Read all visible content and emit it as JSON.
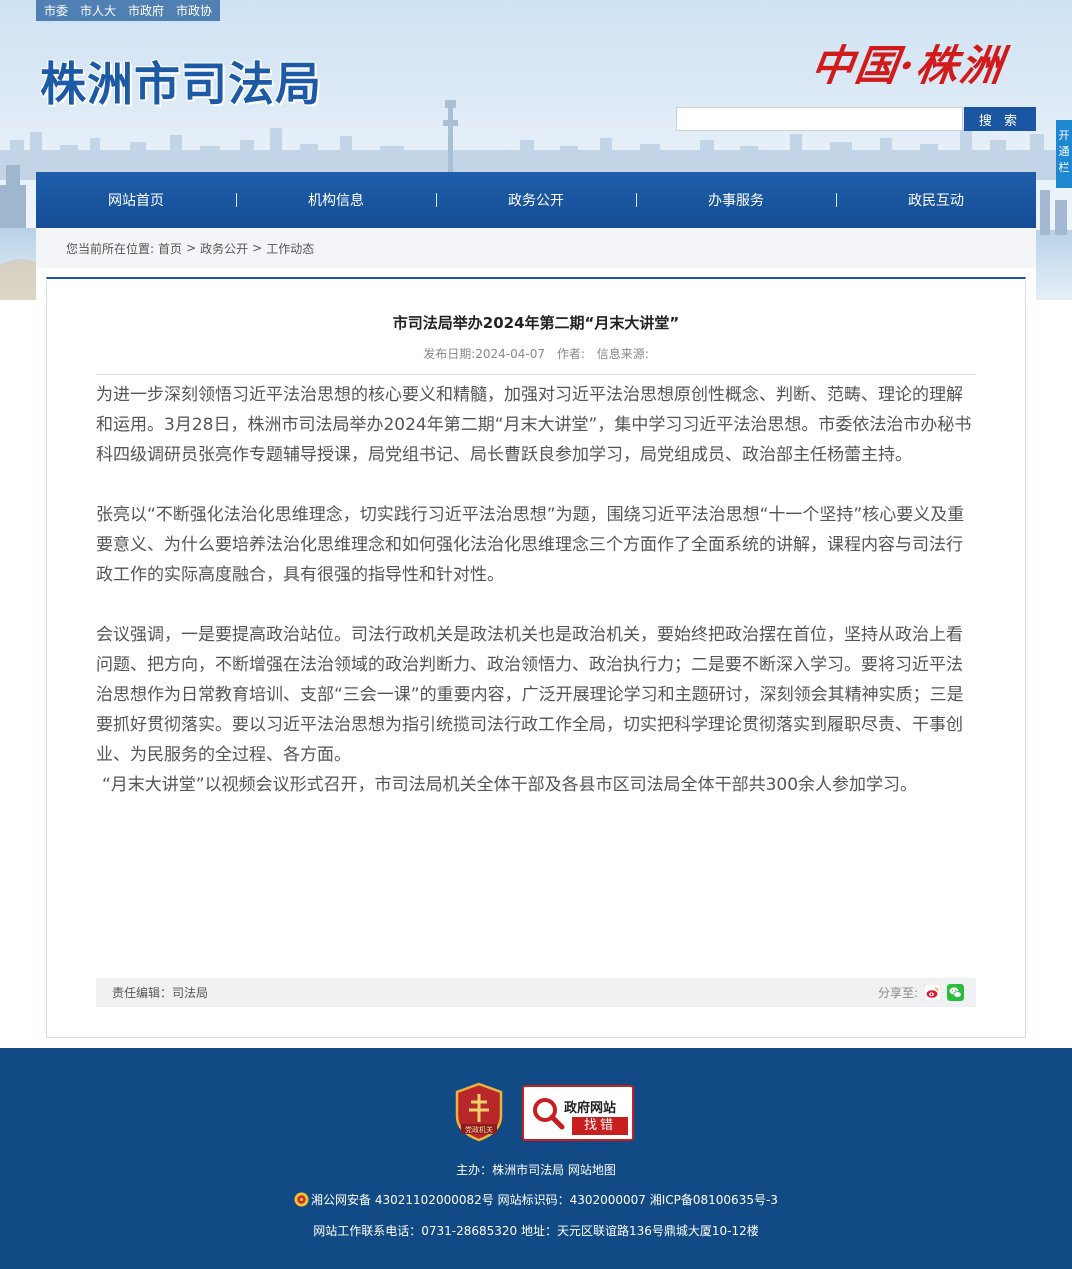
{
  "header": {
    "top_links": [
      "市委",
      "市人大",
      "市政府",
      "市政协"
    ],
    "site_title": "株洲市司法局",
    "slogan": "中国·株洲",
    "search": {
      "placeholder": "",
      "button_label": "搜 索"
    },
    "side_tab": "开通栏"
  },
  "nav": {
    "items": [
      "网站首页",
      "机构信息",
      "政务公开",
      "办事服务",
      "政民互动"
    ]
  },
  "breadcrumb": {
    "prefix": "您当前所在位置:",
    "items": [
      "首页",
      "政务公开",
      "工作动态"
    ],
    "separator": ">"
  },
  "article": {
    "title": "市司法局举办2024年第二期“月末大讲堂”",
    "date_label": "发布日期:",
    "date": "2024-04-07",
    "author_label": "作者:",
    "source_label": "信息来源:",
    "paragraphs": [
      "为进一步深刻领悟习近平法治思想的核心要义和精髓，加强对习近平法治思想原创性概念、判断、范畴、理论的理解和运用。3月28日，株洲市司法局举办2024年第二期“月末大讲堂”，集中学习习近平法治思想。市委依法治市办秘书科四级调研员张亮作专题辅导授课，局党组书记、局长曹跃良参加学习，局党组成员、政治部主任杨蕾主持。",
      "张亮以“不断强化法治化思维理念，切实践行习近平法治思想”为题，围绕习近平法治思想“十一个坚持”核心要义及重要意义、为什么要培养法治化思维理念和如何强化法治化思维理念三个方面作了全面系统的讲解，课程内容与司法行政工作的实际高度融合，具有很强的指导性和针对性。",
      "会议强调，一是要提高政治站位。司法行政机关是政法机关也是政治机关，要始终把政治摆在首位，坚持从政治上看问题、把方向，不断增强在法治领域的政治判断力、政治领悟力、政治执行力；二是要不断深入学习。要将习近平法治思想作为日常教育培训、支部“三会一课”的重要内容，广泛开展理论学习和主题研讨，深刻领会其精神实质；三是要抓好贯彻落实。要以习近平法治思想为指引统揽司法行政工作全局，切实把科学理论贯彻落实到履职尽责、干事创业、为民服务的全过程、各方面。",
      "“月末大讲堂”以视频会议形式召开，市司法局机关全体干部及各县市区司法局全体干部共300余人参加学习。"
    ],
    "editor": "责任编辑：司法局",
    "share_label": "分享至:"
  },
  "footer": {
    "badge_text": "党政机关",
    "gov_err_title": "政府网站",
    "gov_err_action": "找错",
    "line1": "主办：株洲市司法局 网站地图",
    "line2": "湘公网安备 43021102000082号 网站标识码：4302000007 湘ICP备08100635号-3",
    "line3": "网站工作联系电话：0731-28685320 地址：天元区联谊路136号鼎城大厦10-12楼"
  },
  "colors": {
    "brand_blue": "#1a56a2",
    "footer_blue": "#114a85",
    "accent_red": "#c81e1e"
  }
}
